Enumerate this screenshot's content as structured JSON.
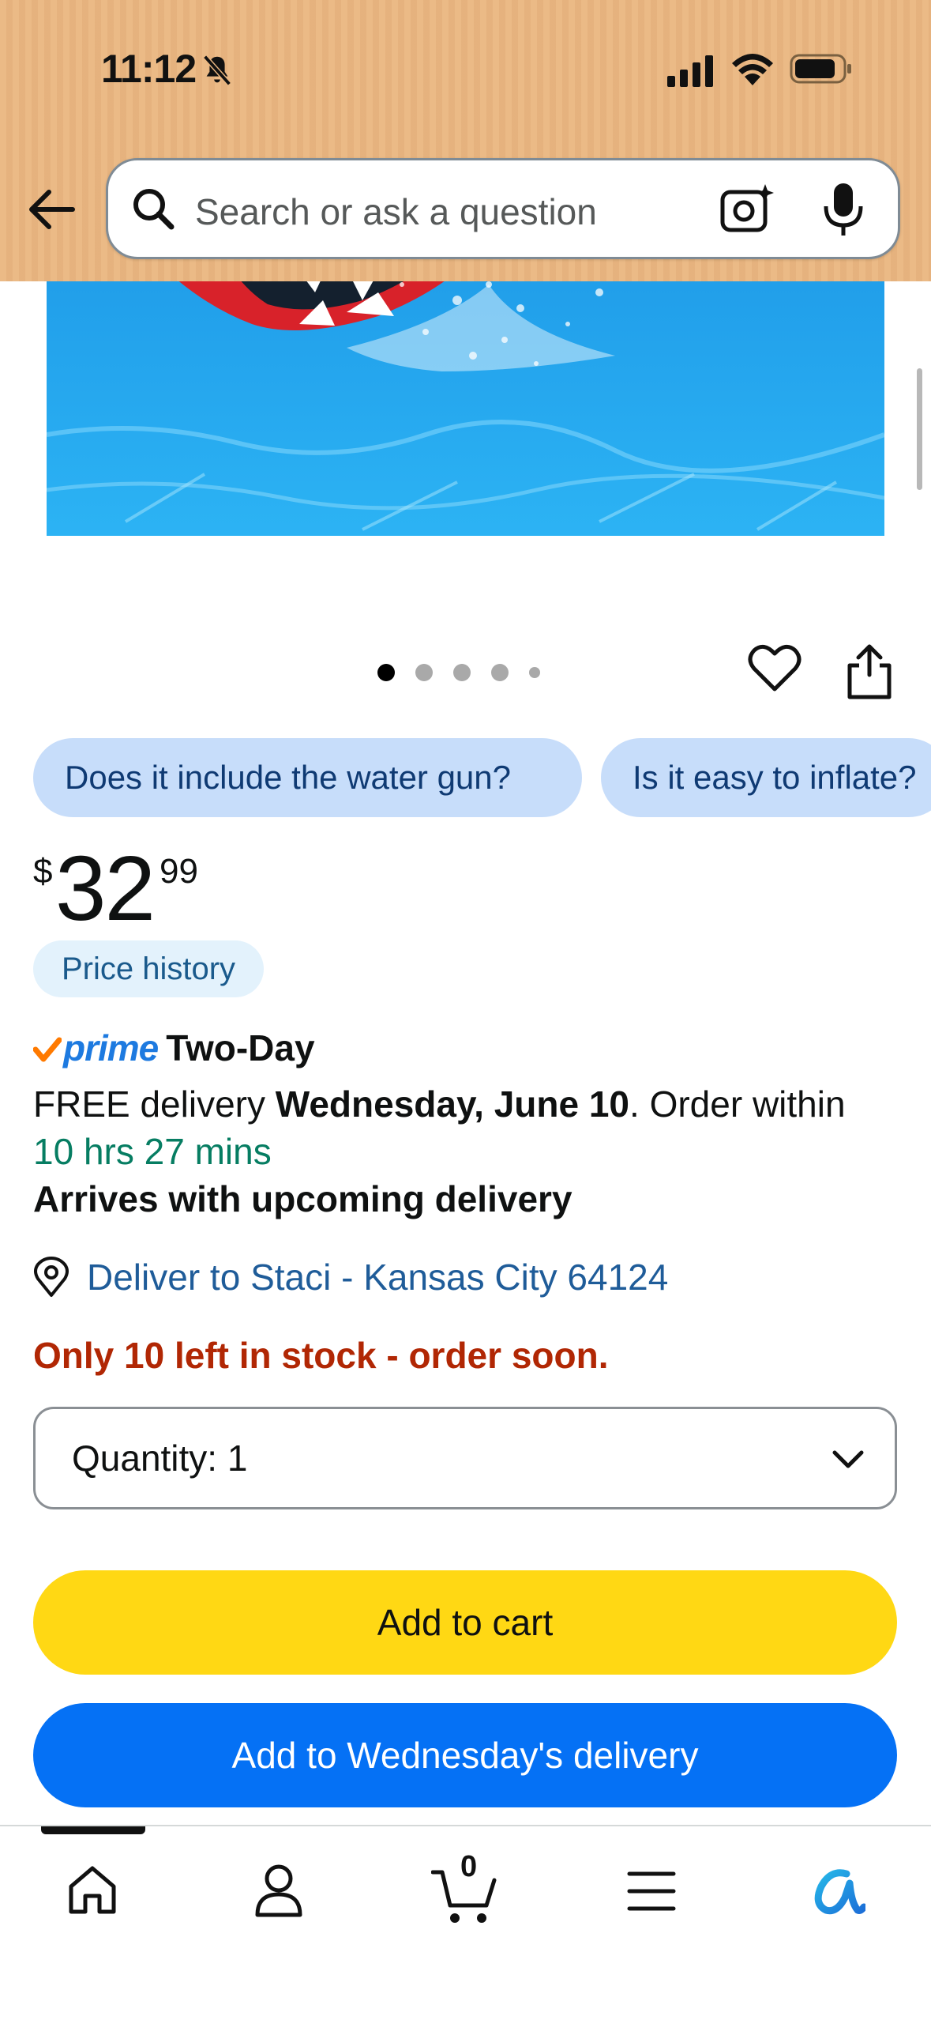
{
  "status_bar": {
    "time": "11:12"
  },
  "search": {
    "placeholder": "Search or ask a question"
  },
  "carousel": {
    "dot_count": 5,
    "active_index": 0
  },
  "questions": [
    {
      "label": "Does it include the water gun?"
    },
    {
      "label": "Is it easy to inflate?"
    }
  ],
  "price": {
    "currency": "$",
    "whole": "32",
    "fraction": "99"
  },
  "price_history_label": "Price history",
  "delivery": {
    "prime_word": "prime",
    "prime_label": "Two-Day",
    "free_text": "FREE delivery ",
    "date": "Wednesday, June 10",
    "order_within": ". Order within",
    "countdown": "10 hrs 27 mins",
    "arrives": "Arrives with upcoming delivery",
    "deliver_to": "Deliver to Staci - Kansas City 64124"
  },
  "stock_message": "Only 10 left in stock - order soon.",
  "quantity": {
    "label": "Quantity:",
    "value": "1"
  },
  "buttons": {
    "add_to_cart": "Add to cart",
    "add_to_delivery": "Add to Wednesday's delivery"
  },
  "nav": {
    "cart_count": "0"
  },
  "colors": {
    "header_bg": "#eab680",
    "add_to_cart": "#ffd814",
    "add_to_delivery": "#0571f5",
    "stock_warning": "#b12704",
    "countdown": "#067d62"
  }
}
